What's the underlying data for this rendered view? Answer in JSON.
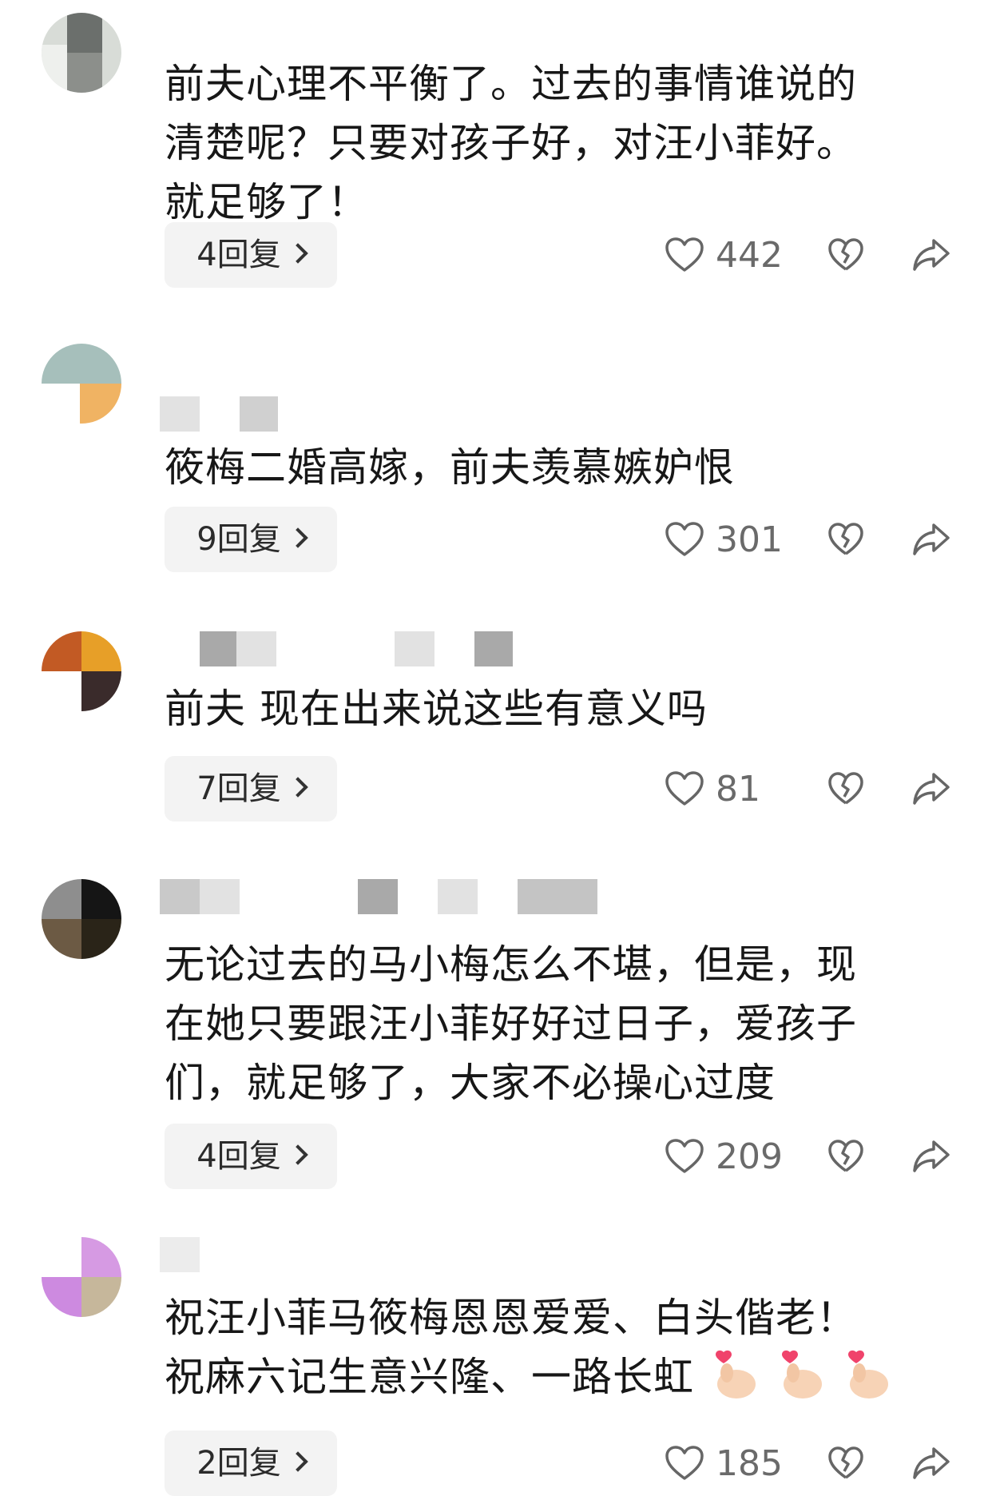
{
  "comments": [
    {
      "text_lines": [
        "前夫心理不平衡了。过去的事情谁说的",
        "清楚呢？只要对孩子好，对汪小菲好。",
        "就足够了！"
      ],
      "replies": "4回复",
      "likes": "442"
    },
    {
      "text_lines": [
        "筱梅二婚高嫁，前夫羡慕嫉妒恨"
      ],
      "replies": "9回复",
      "likes": "301"
    },
    {
      "text_lines": [
        "前夫 现在出来说这些有意义吗"
      ],
      "replies": "7回复",
      "likes": "81"
    },
    {
      "text_lines": [
        "无论过去的马小梅怎么不堪，但是，现",
        "在她只要跟汪小菲好好过日子，爱孩子",
        "们，就足够了，大家不必操心过度"
      ],
      "replies": "4回复",
      "likes": "209"
    },
    {
      "text_lines": [
        "祝汪小菲马筱梅恩恩爱爱、白头偕老！",
        "祝麻六记生意兴隆、一路长虹"
      ],
      "replies": "2回复",
      "likes": "185"
    }
  ],
  "icons": {
    "like": "heart-outline-icon",
    "dislike": "broken-heart-icon",
    "share": "share-arrow-icon",
    "emoji": "finger-heart-emoji"
  },
  "colors": {
    "text": "#171717",
    "count": "#6a6a6a",
    "reply_bg": "#f3f3f3",
    "emoji_heart": "#f0436b",
    "emoji_hand": "#f7d3b6"
  }
}
